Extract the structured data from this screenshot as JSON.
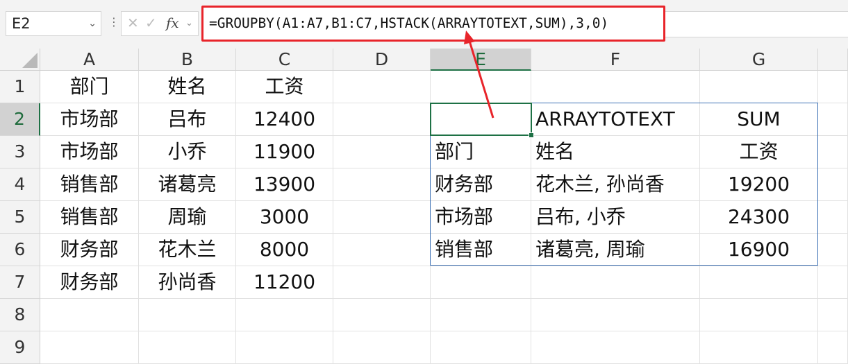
{
  "name_box": "E2",
  "formula": "=GROUPBY(A1:A7,B1:C7,HSTACK(ARRAYTOTEXT,SUM),3,0)",
  "toolbar": {
    "cancel_icon": "close-icon",
    "confirm_icon": "check-icon",
    "fx_label": "fx"
  },
  "columns": [
    "A",
    "B",
    "C",
    "D",
    "E",
    "F",
    "G"
  ],
  "rows": [
    "1",
    "2",
    "3",
    "4",
    "5",
    "6",
    "7",
    "8",
    "9"
  ],
  "cells": {
    "A1": "部门",
    "B1": "姓名",
    "C1": "工资",
    "A2": "市场部",
    "B2": "吕布",
    "C2": "12400",
    "A3": "市场部",
    "B3": "小乔",
    "C3": "11900",
    "A4": "销售部",
    "B4": "诸葛亮",
    "C4": "13900",
    "A5": "销售部",
    "B5": "周瑜",
    "C5": "3000",
    "A6": "财务部",
    "B6": "花木兰",
    "C6": "8000",
    "A7": "财务部",
    "B7": "孙尚香",
    "C7": "11200",
    "F2": "ARRAYTOTEXT",
    "G2": "SUM",
    "E3": "部门",
    "F3": "姓名",
    "G3": "工资",
    "E4": "财务部",
    "F4": "花木兰, 孙尚香",
    "G4": "19200",
    "E5": "市场部",
    "F5": "吕布, 小乔",
    "G5": "24300",
    "E6": "销售部",
    "F6": "诸葛亮, 周瑜",
    "G6": "16900"
  },
  "colors": {
    "highlight_red": "#e8242a",
    "selection_green": "#1e7145",
    "table_border": "#3b6fb4"
  }
}
